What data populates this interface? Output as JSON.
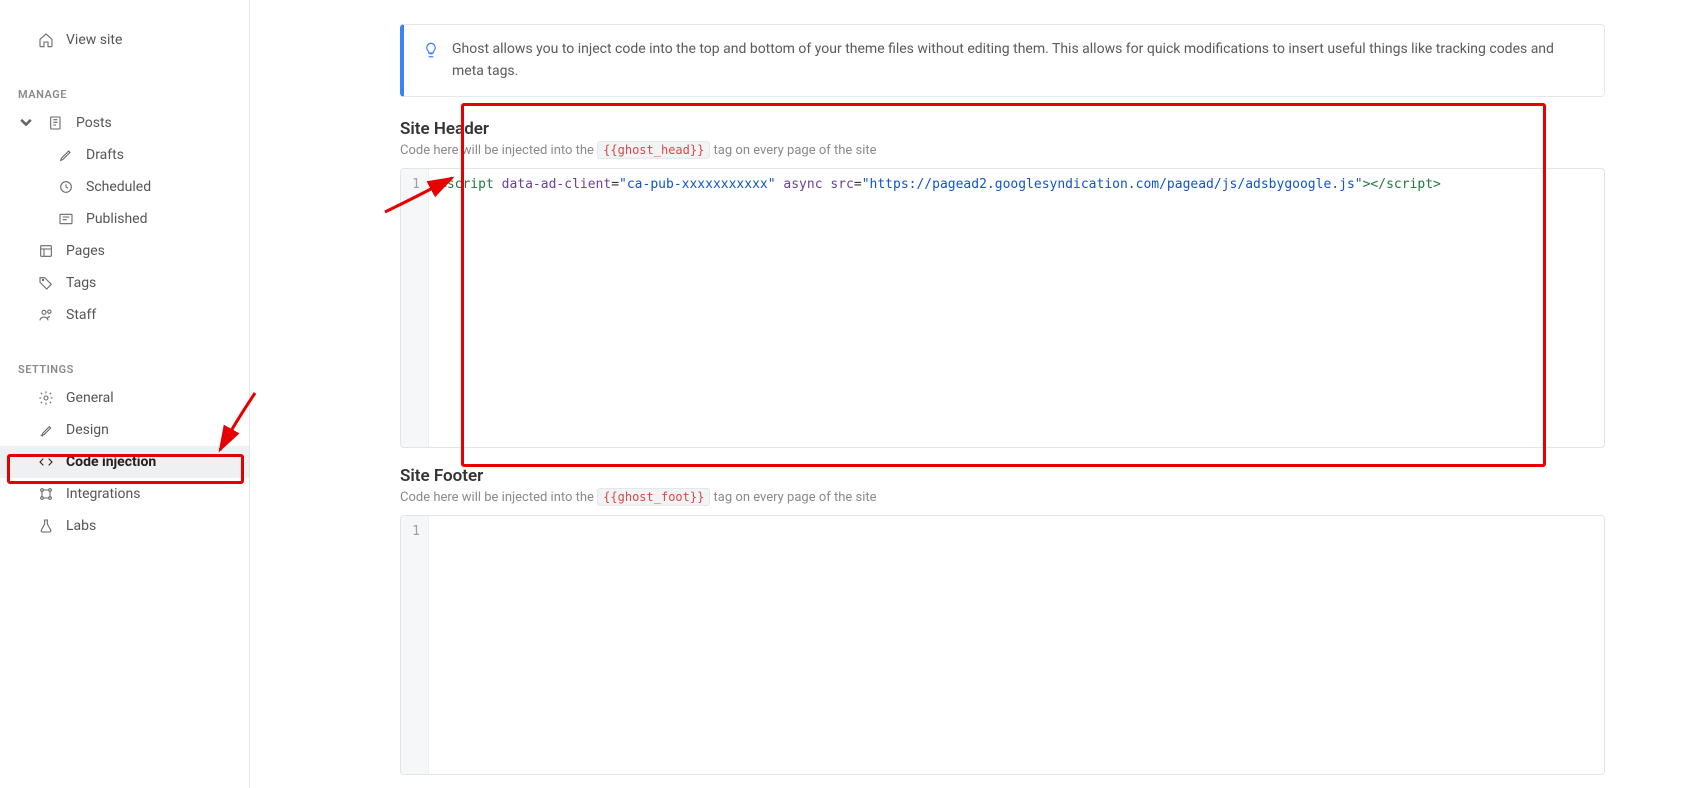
{
  "sidebar": {
    "view_site": "View site",
    "section_manage": "MANAGE",
    "section_settings": "SETTINGS",
    "posts": "Posts",
    "drafts": "Drafts",
    "scheduled": "Scheduled",
    "published": "Published",
    "pages": "Pages",
    "tags": "Tags",
    "staff": "Staff",
    "general": "General",
    "design": "Design",
    "code_injection": "Code injection",
    "integrations": "Integrations",
    "labs": "Labs"
  },
  "info_text": "Ghost allows you to inject code into the top and bottom of your theme files without editing them. This allows for quick modifications to insert useful things like tracking codes and meta tags.",
  "header": {
    "title": "Site Header",
    "desc_before": "Code here will be injected into the ",
    "tag": "{{ghost_head}}",
    "desc_after": " tag on every page of the site",
    "line_no": "1",
    "code": {
      "open": "<script",
      "attr1": " data-ad-client",
      "eq1": "=",
      "val1": "\"ca-pub-xxxxxxxxxxx\"",
      "attr2": " async",
      "attr3": " src",
      "eq3": "=",
      "val3": "\"https://pagead2.googlesyndication.com/pagead/js/adsbygoogle.js\"",
      "close1": ">",
      "close2": "</script>"
    }
  },
  "footer": {
    "title": "Site Footer",
    "desc_before": "Code here will be injected into the ",
    "tag": "{{ghost_foot}}",
    "desc_after": " tag on every page of the site",
    "line_no": "1"
  }
}
